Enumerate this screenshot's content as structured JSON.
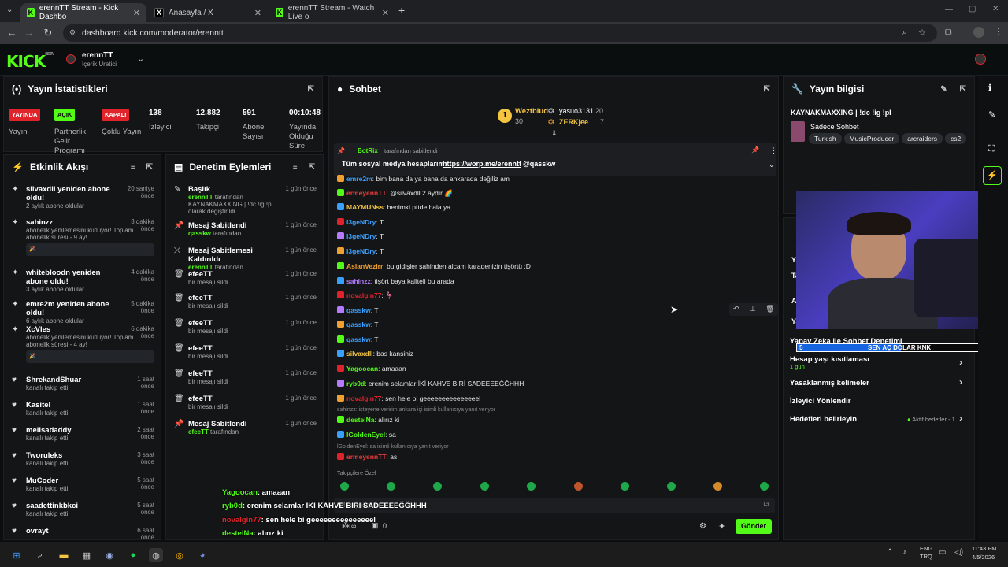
{
  "browser": {
    "tabs": [
      {
        "label": "erennTT Stream - Kick Dashbo",
        "icon": "kick-favicon",
        "active": true
      },
      {
        "label": "Anasayfa / X",
        "icon": "x-favicon",
        "active": false
      },
      {
        "label": "erennTT Stream - Watch Live o",
        "icon": "kick-favicon",
        "active": false
      }
    ],
    "url": "dashboard.kick.com/moderator/erenntt"
  },
  "header": {
    "logo": "KICK",
    "logo_sup": "BETA",
    "channel_name": "erennTT",
    "channel_role": "İçerik Üretici"
  },
  "stats": {
    "title": "Yayın İstatistikleri",
    "items": [
      {
        "badge": "YAYINDA",
        "label": "Yayın",
        "badge_color": "#e0232b"
      },
      {
        "badge": "AÇIK",
        "label": "Partnerlik Gelir Programı",
        "badge_color": "#53fc18"
      },
      {
        "badge": "KAPALI",
        "label": "Çoklu Yayın",
        "badge_color": "#e0232b"
      },
      {
        "value": "138",
        "label": "İzleyici"
      },
      {
        "value": "12.882",
        "label": "Takipçi"
      },
      {
        "value": "591",
        "label": "Abone Sayısı"
      },
      {
        "value": "00:10:48",
        "label": "Yayında Olduğu Süre"
      }
    ]
  },
  "activity": {
    "title": "Etkinlik Akışı",
    "items": [
      {
        "title": "silvaxdll yeniden abone oldu!",
        "sub": "2 aylık abone oldular",
        "time": "20 saniye önce",
        "icon": "star-icon"
      },
      {
        "title": "sahinzz",
        "sub": "abonelik yenilemesini kutluyor! Toplam abonelik süresi - 9 ay!",
        "time": "3 dakika önce",
        "icon": "star-icon",
        "msg": "🎉"
      },
      {
        "title": "whitebloodn yeniden abone oldu!",
        "sub": "3 aylık abone oldular",
        "time": "4 dakika önce",
        "icon": "star-icon"
      },
      {
        "title": "emre2m yeniden abone oldu!",
        "sub": "6 aylık abone oldular",
        "time": "5 dakika önce",
        "icon": "star-icon"
      },
      {
        "title": "XcVles",
        "sub": "abonelik yenilemesini kutluyor! Toplam abonelik süresi - 4 ay!",
        "time": "6 dakika önce",
        "icon": "star-icon",
        "msg": "🎉"
      },
      {
        "title": "ShrekandShuar",
        "sub": "kanalı takip etti",
        "time": "1 saat önce",
        "icon": "heart-icon"
      },
      {
        "title": "Kasitel",
        "sub": "kanalı takip etti",
        "time": "1 saat önce",
        "icon": "heart-icon"
      },
      {
        "title": "melisadaddy",
        "sub": "kanalı takip etti",
        "time": "2 saat önce",
        "icon": "heart-icon"
      },
      {
        "title": "Tworuleks",
        "sub": "kanalı takip etti",
        "time": "3 saat önce",
        "icon": "heart-icon"
      },
      {
        "title": "MuCoder",
        "sub": "kanalı takip etti",
        "time": "5 saat önce",
        "icon": "heart-icon"
      },
      {
        "title": "saadettinkbkci",
        "sub": "kanalı takip etti",
        "time": "5 saat önce",
        "icon": "heart-icon"
      },
      {
        "title": "ovrayt",
        "sub": "",
        "time": "6 saat önce",
        "icon": "heart-icon"
      }
    ]
  },
  "moderation": {
    "title": "Denetim Eylemleri",
    "items": [
      {
        "title": "Başlık",
        "sub_user": "erennTT",
        "sub": "tarafından KAYNAKMAXXING | !dc !ig !pl olarak değiştirildi",
        "time": "1 gün önce",
        "icon": "pencil-icon"
      },
      {
        "title": "Mesaj Sabitlendi",
        "sub_user": "qasskw",
        "sub": "tarafından",
        "time": "1 gün önce",
        "icon": "pin-icon"
      },
      {
        "title": "Mesaj Sabitlemesi Kaldırıldı",
        "sub_user": "erennTT",
        "sub": "tarafından",
        "time": "1 gün önce",
        "icon": "unpin-icon"
      },
      {
        "title": "efeeTT",
        "sub_user": "",
        "sub": "bir mesajı sildi",
        "time": "1 gün önce",
        "icon": "trash-icon"
      },
      {
        "title": "efeeTT",
        "sub_user": "",
        "sub": "bir mesajı sildi",
        "time": "1 gün önce",
        "icon": "trash-icon"
      },
      {
        "title": "efeeTT",
        "sub_user": "",
        "sub": "bir mesajı sildi",
        "time": "1 gün önce",
        "icon": "trash-icon"
      },
      {
        "title": "efeeTT",
        "sub_user": "",
        "sub": "bir mesajı sildi",
        "time": "1 gün önce",
        "icon": "trash-icon"
      },
      {
        "title": "efeeTT",
        "sub_user": "",
        "sub": "bir mesajı sildi",
        "time": "1 gün önce",
        "icon": "trash-icon"
      },
      {
        "title": "efeeTT",
        "sub_user": "",
        "sub": "bir mesajı sildi",
        "time": "1 gün önce",
        "icon": "trash-icon"
      },
      {
        "title": "Mesaj Sabitlendi",
        "sub_user": "efeeTT",
        "sub": "tarafından",
        "time": "1 gün önce",
        "icon": "pin-icon"
      }
    ]
  },
  "chat": {
    "title": "Sohbet",
    "leaderboard": [
      {
        "name": "Weztblud",
        "count": "30",
        "rank": "1"
      },
      {
        "name": "yasuo3131",
        "count": "20"
      },
      {
        "name": "ZERKjee",
        "count": "7"
      }
    ],
    "pinned": {
      "by_user": "BotRix",
      "by_label": "tarafından sabitlendi",
      "text": "Tüm sosyal medya hesaplarım:",
      "link": "https://worp.me/erenntt",
      "mention": "@qasskw"
    },
    "messages": [
      {
        "user": "emre2m",
        "color": "#3aa0ff",
        "text": "bim bana da ya bana da ankarada değiliz am"
      },
      {
        "user": "ermeyennTT",
        "color": "#e83b3b",
        "text": "@silvaxdll 2 aydır 🌈"
      },
      {
        "user": "MAYMUNss",
        "color": "#f5c542",
        "text": "benimki pttde hala ya"
      },
      {
        "user": "l3geNDry",
        "color": "#3aa0ff",
        "text": "T"
      },
      {
        "user": "l3geNDry",
        "color": "#3aa0ff",
        "text": "T"
      },
      {
        "user": "l3geNDry",
        "color": "#3aa0ff",
        "text": "T"
      },
      {
        "user": "AslanVezirr",
        "color": "#f0a030",
        "text": "bu gidişler şahinden alcam karadenizin tişörtü :D"
      },
      {
        "user": "sahinzz",
        "color": "#b57aff",
        "text": "tişört baya kaliteli bu arada"
      },
      {
        "user": "novalgin77",
        "color": "#e0232b",
        "text": "🦩"
      },
      {
        "user": "qasskw",
        "color": "#3aa0ff",
        "text": "T"
      },
      {
        "user": "qasskw",
        "color": "#3aa0ff",
        "text": "T"
      },
      {
        "user": "qasskw",
        "color": "#3aa0ff",
        "text": "T"
      },
      {
        "user": "silvaxdll",
        "color": "#f5c542",
        "text": "bas kansiniz"
      },
      {
        "user": "Yagoocan",
        "color": "#53fc18",
        "text": "amaaan"
      },
      {
        "user": "ryb0d",
        "color": "#53fc18",
        "text": "erenim selamlar İKİ KAHVE BİRİ SADEEEEĞĞHHH"
      },
      {
        "user": "novalgin77",
        "color": "#e0232b",
        "text": "sen hele bi geeeeeeeeeeeeeeel"
      },
      {
        "user": "desteiNa",
        "color": "#53fc18",
        "text": "alırız ki"
      },
      {
        "user": "lGoldenEyel",
        "color": "#53fc18",
        "text": "sa"
      },
      {
        "user": "ermeyennTT",
        "color": "#e83b3b",
        "text": "as"
      }
    ],
    "reply1": "sahinzz: isteyene veririm ankara içi isimli kullanıcıya yanıt veriyor",
    "reply2": "lGoldenEyel: sa isimli kullanıcıya yanıt veriyor",
    "followers_only": "Takipçilere Özel",
    "input_placeholder": "Mesaj gönder",
    "send_label": "Gönder",
    "count_infinite": "∞",
    "count_zero": "0"
  },
  "stream_info": {
    "title": "Yayın bilgisi",
    "stream_title": "KAYNAKMAXXING | !dc !ig !pl",
    "category": "Sadece Sohbet",
    "tags": [
      "Turkish",
      "MusicProducer",
      "arcraiders",
      "cs2"
    ]
  },
  "mod_settings": {
    "title": "Sohbet Denetimi",
    "items": [
      {
        "label": "Yapay Zeka ile Sohbet Denetimi"
      },
      {
        "label": "Hesap yaşı kısıtlaması",
        "value": "1 gün"
      },
      {
        "label": "Yasaklanmış kelimeler"
      },
      {
        "label": "İzleyici Yönlendir"
      },
      {
        "label": "Hedefleri belirleyin",
        "value": "Aktif hedefler - 1"
      }
    ]
  },
  "goal_bar": {
    "left": "5",
    "text": "SEN AÇ DOLAR KNK",
    "right": "10",
    "progress": 0.5
  },
  "overlay_chat": [
    {
      "user": "Yagoocan",
      "text": ": amaaan",
      "color": "#53fc18"
    },
    {
      "user": "ryb0d",
      "text": ": erenim selamlar İKİ KAHVE BİRİ SADEEEEĞĞHHH",
      "color": "#53fc18"
    },
    {
      "user": "novalgin77",
      "text": ": sen hele bi geeeeeeeeeeeeeeel",
      "color": "#e0232b"
    },
    {
      "user": "desteiNa",
      "text": ": alırız ki",
      "color": "#53fc18"
    },
    {
      "user": "lGoldenEyel",
      "text": ": sa",
      "color": "#53fc18"
    },
    {
      "user": "ermeyennTT",
      "text": ": as",
      "color": "#e83b3b"
    }
  ],
  "taskbar": {
    "lang1": "ENG",
    "lang2": "TRQ",
    "time": "11:43 PM",
    "date": "4/5/2026"
  },
  "colors": {
    "accent": "#53fc18",
    "live": "#e0232b",
    "panel": "#141517"
  }
}
